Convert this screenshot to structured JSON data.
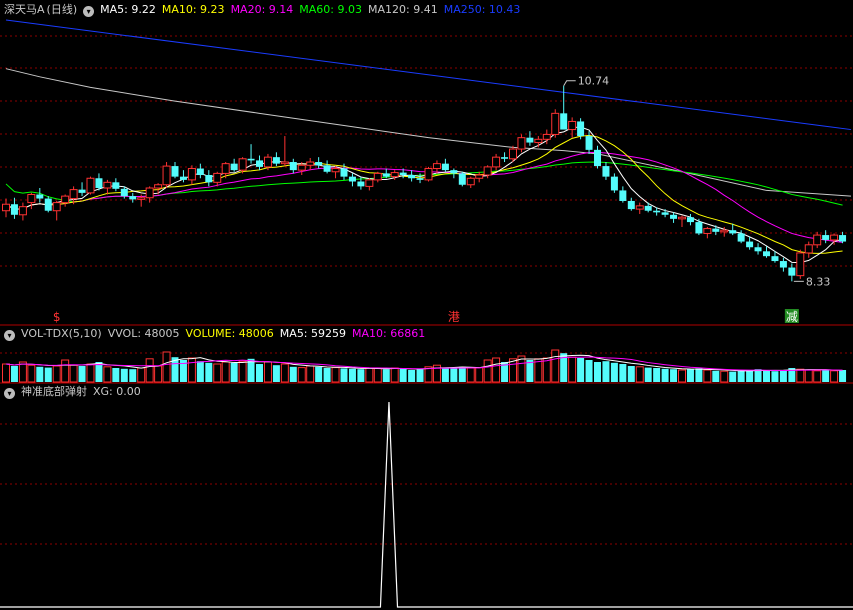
{
  "stock": {
    "name": "深天马A",
    "period": "(日线)"
  },
  "main_header": [
    {
      "label": "MA5: 9.22",
      "color": "#ffffff"
    },
    {
      "label": "MA10: 9.23",
      "color": "#ffff00"
    },
    {
      "label": "MA20: 9.14",
      "color": "#ff00ff"
    },
    {
      "label": "MA60: 9.03",
      "color": "#00ff00"
    },
    {
      "label": "MA120: 9.41",
      "color": "#c8c8c8"
    },
    {
      "label": "MA250: 10.43",
      "color": "#1a3cff"
    }
  ],
  "vol_header": [
    {
      "label": "VOL-TDX(5,10)",
      "color": "#c8c8c8"
    },
    {
      "label": "VVOL: 48005",
      "color": "#c8c8c8"
    },
    {
      "label": "VOLUME: 48006",
      "color": "#ffff00"
    },
    {
      "label": "MA5: 59259",
      "color": "#ffffff"
    },
    {
      "label": "MA10: 66861",
      "color": "#ff00ff"
    }
  ],
  "ind_header": [
    {
      "label": "神准底部弹射",
      "color": "#c8c8c8"
    },
    {
      "label": "XG: 0.00",
      "color": "#c8c8c8"
    }
  ],
  "annotations": {
    "high_label": "10.74",
    "low_label": "8.33"
  },
  "markers": [
    "$",
    "港",
    "减"
  ],
  "colors": {
    "up": "#ff3232",
    "down": "#54fcfc",
    "grid": "#8b0000",
    "separator": "#b00000",
    "ma5": "#ffffff",
    "ma10": "#ffff00",
    "ma20": "#ff00ff",
    "ma60": "#00ff00",
    "ma120": "#c8c8c8",
    "ma250": "#1a3cff"
  },
  "chart_data": [
    {
      "type": "candlestick",
      "title": "深天马A (日线)",
      "ylim": [
        8.1,
        11.55
      ],
      "ohlc": [
        [
          9.2,
          9.35,
          9.12,
          9.28
        ],
        [
          9.28,
          9.36,
          9.1,
          9.15
        ],
        [
          9.15,
          9.3,
          9.08,
          9.25
        ],
        [
          9.3,
          9.42,
          9.22,
          9.4
        ],
        [
          9.4,
          9.48,
          9.3,
          9.35
        ],
        [
          9.35,
          9.38,
          9.18,
          9.2
        ],
        [
          9.2,
          9.32,
          9.08,
          9.3
        ],
        [
          9.3,
          9.4,
          9.25,
          9.38
        ],
        [
          9.35,
          9.5,
          9.28,
          9.46
        ],
        [
          9.46,
          9.55,
          9.38,
          9.42
        ],
        [
          9.42,
          9.62,
          9.4,
          9.6
        ],
        [
          9.6,
          9.66,
          9.45,
          9.48
        ],
        [
          9.48,
          9.58,
          9.4,
          9.55
        ],
        [
          9.55,
          9.6,
          9.44,
          9.47
        ],
        [
          9.47,
          9.5,
          9.35,
          9.38
        ],
        [
          9.38,
          9.42,
          9.3,
          9.34
        ],
        [
          9.34,
          9.4,
          9.25,
          9.36
        ],
        [
          9.36,
          9.5,
          9.3,
          9.48
        ],
        [
          9.48,
          9.54,
          9.4,
          9.52
        ],
        [
          9.52,
          9.8,
          9.48,
          9.75
        ],
        [
          9.75,
          9.8,
          9.6,
          9.62
        ],
        [
          9.62,
          9.7,
          9.55,
          9.58
        ],
        [
          9.58,
          9.76,
          9.52,
          9.72
        ],
        [
          9.72,
          9.78,
          9.6,
          9.64
        ],
        [
          9.64,
          9.7,
          9.5,
          9.55
        ],
        [
          9.55,
          9.68,
          9.5,
          9.66
        ],
        [
          9.66,
          9.8,
          9.6,
          9.78
        ],
        [
          9.78,
          9.84,
          9.68,
          9.7
        ],
        [
          9.7,
          9.86,
          9.66,
          9.84
        ],
        [
          9.84,
          10.02,
          9.78,
          9.82
        ],
        [
          9.82,
          9.88,
          9.7,
          9.74
        ],
        [
          9.74,
          9.9,
          9.7,
          9.86
        ],
        [
          9.86,
          9.92,
          9.75,
          9.78
        ],
        [
          9.78,
          10.12,
          9.75,
          9.8
        ],
        [
          9.8,
          9.84,
          9.66,
          9.7
        ],
        [
          9.7,
          9.8,
          9.64,
          9.76
        ],
        [
          9.76,
          9.85,
          9.7,
          9.8
        ],
        [
          9.8,
          9.86,
          9.72,
          9.76
        ],
        [
          9.76,
          9.82,
          9.66,
          9.68
        ],
        [
          9.68,
          9.75,
          9.6,
          9.72
        ],
        [
          9.72,
          9.78,
          9.58,
          9.62
        ],
        [
          9.62,
          9.66,
          9.5,
          9.56
        ],
        [
          9.56,
          9.62,
          9.46,
          9.5
        ],
        [
          9.5,
          9.6,
          9.45,
          9.58
        ],
        [
          9.58,
          9.68,
          9.55,
          9.66
        ],
        [
          9.66,
          9.72,
          9.6,
          9.62
        ],
        [
          9.62,
          9.7,
          9.58,
          9.67
        ],
        [
          9.67,
          9.72,
          9.6,
          9.64
        ],
        [
          9.64,
          9.7,
          9.56,
          9.6
        ],
        [
          9.6,
          9.66,
          9.54,
          9.58
        ],
        [
          9.58,
          9.74,
          9.56,
          9.72
        ],
        [
          9.72,
          9.82,
          9.66,
          9.78
        ],
        [
          9.78,
          9.84,
          9.68,
          9.7
        ],
        [
          9.7,
          9.72,
          9.6,
          9.66
        ],
        [
          9.66,
          9.68,
          9.5,
          9.52
        ],
        [
          9.52,
          9.62,
          9.48,
          9.6
        ],
        [
          9.6,
          9.68,
          9.55,
          9.64
        ],
        [
          9.64,
          9.76,
          9.6,
          9.74
        ],
        [
          9.74,
          9.9,
          9.7,
          9.86
        ],
        [
          9.86,
          9.92,
          9.8,
          9.84
        ],
        [
          9.84,
          10.0,
          9.8,
          9.96
        ],
        [
          9.96,
          10.14,
          9.92,
          10.1
        ],
        [
          10.1,
          10.18,
          10.0,
          10.04
        ],
        [
          10.04,
          10.12,
          9.98,
          10.08
        ],
        [
          10.08,
          10.2,
          10.02,
          10.14
        ],
        [
          10.14,
          10.45,
          10.1,
          10.4
        ],
        [
          10.4,
          10.74,
          10.35,
          10.2
        ],
        [
          10.2,
          10.35,
          10.1,
          10.3
        ],
        [
          10.3,
          10.34,
          10.08,
          10.12
        ],
        [
          10.12,
          10.18,
          9.9,
          9.95
        ],
        [
          9.95,
          10.0,
          9.72,
          9.75
        ],
        [
          9.75,
          9.8,
          9.58,
          9.62
        ],
        [
          9.62,
          9.66,
          9.42,
          9.45
        ],
        [
          9.45,
          9.5,
          9.3,
          9.32
        ],
        [
          9.32,
          9.36,
          9.2,
          9.22
        ],
        [
          9.22,
          9.3,
          9.16,
          9.26
        ],
        [
          9.26,
          9.3,
          9.18,
          9.2
        ],
        [
          9.2,
          9.24,
          9.14,
          9.18
        ],
        [
          9.18,
          9.22,
          9.12,
          9.15
        ],
        [
          9.15,
          9.18,
          9.05,
          9.1
        ],
        [
          9.1,
          9.14,
          9.0,
          9.12
        ],
        [
          9.12,
          9.16,
          9.02,
          9.06
        ],
        [
          9.06,
          9.1,
          8.9,
          8.92
        ],
        [
          8.92,
          9.0,
          8.86,
          8.98
        ],
        [
          8.98,
          9.02,
          8.9,
          8.94
        ],
        [
          8.94,
          9.0,
          8.88,
          8.96
        ],
        [
          8.96,
          9.04,
          8.9,
          8.92
        ],
        [
          8.92,
          8.96,
          8.8,
          8.82
        ],
        [
          8.82,
          8.88,
          8.72,
          8.75
        ],
        [
          8.75,
          8.8,
          8.66,
          8.7
        ],
        [
          8.7,
          8.76,
          8.62,
          8.64
        ],
        [
          8.64,
          8.7,
          8.56,
          8.58
        ],
        [
          8.58,
          8.62,
          8.45,
          8.5
        ],
        [
          8.5,
          8.55,
          8.33,
          8.4
        ],
        [
          8.4,
          8.72,
          8.36,
          8.68
        ],
        [
          8.68,
          8.82,
          8.62,
          8.78
        ],
        [
          8.78,
          8.94,
          8.74,
          8.9
        ],
        [
          8.9,
          8.96,
          8.8,
          8.84
        ],
        [
          8.84,
          8.92,
          8.78,
          8.9
        ],
        [
          8.9,
          8.94,
          8.8,
          8.82
        ]
      ],
      "ma250": [
        [
          0,
          11.55
        ],
        [
          100,
          10.2
        ]
      ],
      "ma120": [
        [
          0,
          10.95
        ],
        [
          4,
          10.85
        ],
        [
          10,
          10.72
        ],
        [
          20,
          10.55
        ],
        [
          30,
          10.4
        ],
        [
          40,
          10.25
        ],
        [
          50,
          10.1
        ],
        [
          60,
          9.98
        ],
        [
          66,
          9.94
        ],
        [
          70,
          9.9
        ],
        [
          80,
          9.68
        ],
        [
          90,
          9.45
        ],
        [
          100,
          9.38
        ]
      ]
    },
    {
      "type": "bar",
      "title": "VOL-TDX(5,10)",
      "ylim": [
        0,
        1
      ],
      "values": [
        0.45,
        0.4,
        0.5,
        0.42,
        0.38,
        0.36,
        0.4,
        0.55,
        0.42,
        0.4,
        0.45,
        0.5,
        0.38,
        0.35,
        0.33,
        0.32,
        0.35,
        0.58,
        0.4,
        0.75,
        0.62,
        0.55,
        0.6,
        0.52,
        0.48,
        0.45,
        0.5,
        0.48,
        0.52,
        0.58,
        0.45,
        0.5,
        0.42,
        0.45,
        0.38,
        0.36,
        0.4,
        0.38,
        0.35,
        0.36,
        0.34,
        0.33,
        0.32,
        0.35,
        0.34,
        0.32,
        0.35,
        0.33,
        0.3,
        0.32,
        0.38,
        0.42,
        0.36,
        0.34,
        0.38,
        0.35,
        0.36,
        0.55,
        0.6,
        0.5,
        0.58,
        0.65,
        0.55,
        0.58,
        0.6,
        0.8,
        0.72,
        0.62,
        0.6,
        0.55,
        0.5,
        0.52,
        0.48,
        0.45,
        0.4,
        0.38,
        0.36,
        0.35,
        0.33,
        0.32,
        0.3,
        0.32,
        0.34,
        0.3,
        0.28,
        0.27,
        0.26,
        0.28,
        0.3,
        0.32,
        0.28,
        0.27,
        0.3,
        0.35,
        0.32,
        0.3,
        0.28,
        0.3,
        0.28,
        0.3
      ]
    },
    {
      "type": "line",
      "title": "神准底部弹射",
      "ylim": [
        0,
        1
      ],
      "x": [
        0,
        44.6,
        45.6,
        46.6,
        100
      ],
      "values": [
        0,
        0,
        1,
        0,
        0
      ]
    }
  ]
}
